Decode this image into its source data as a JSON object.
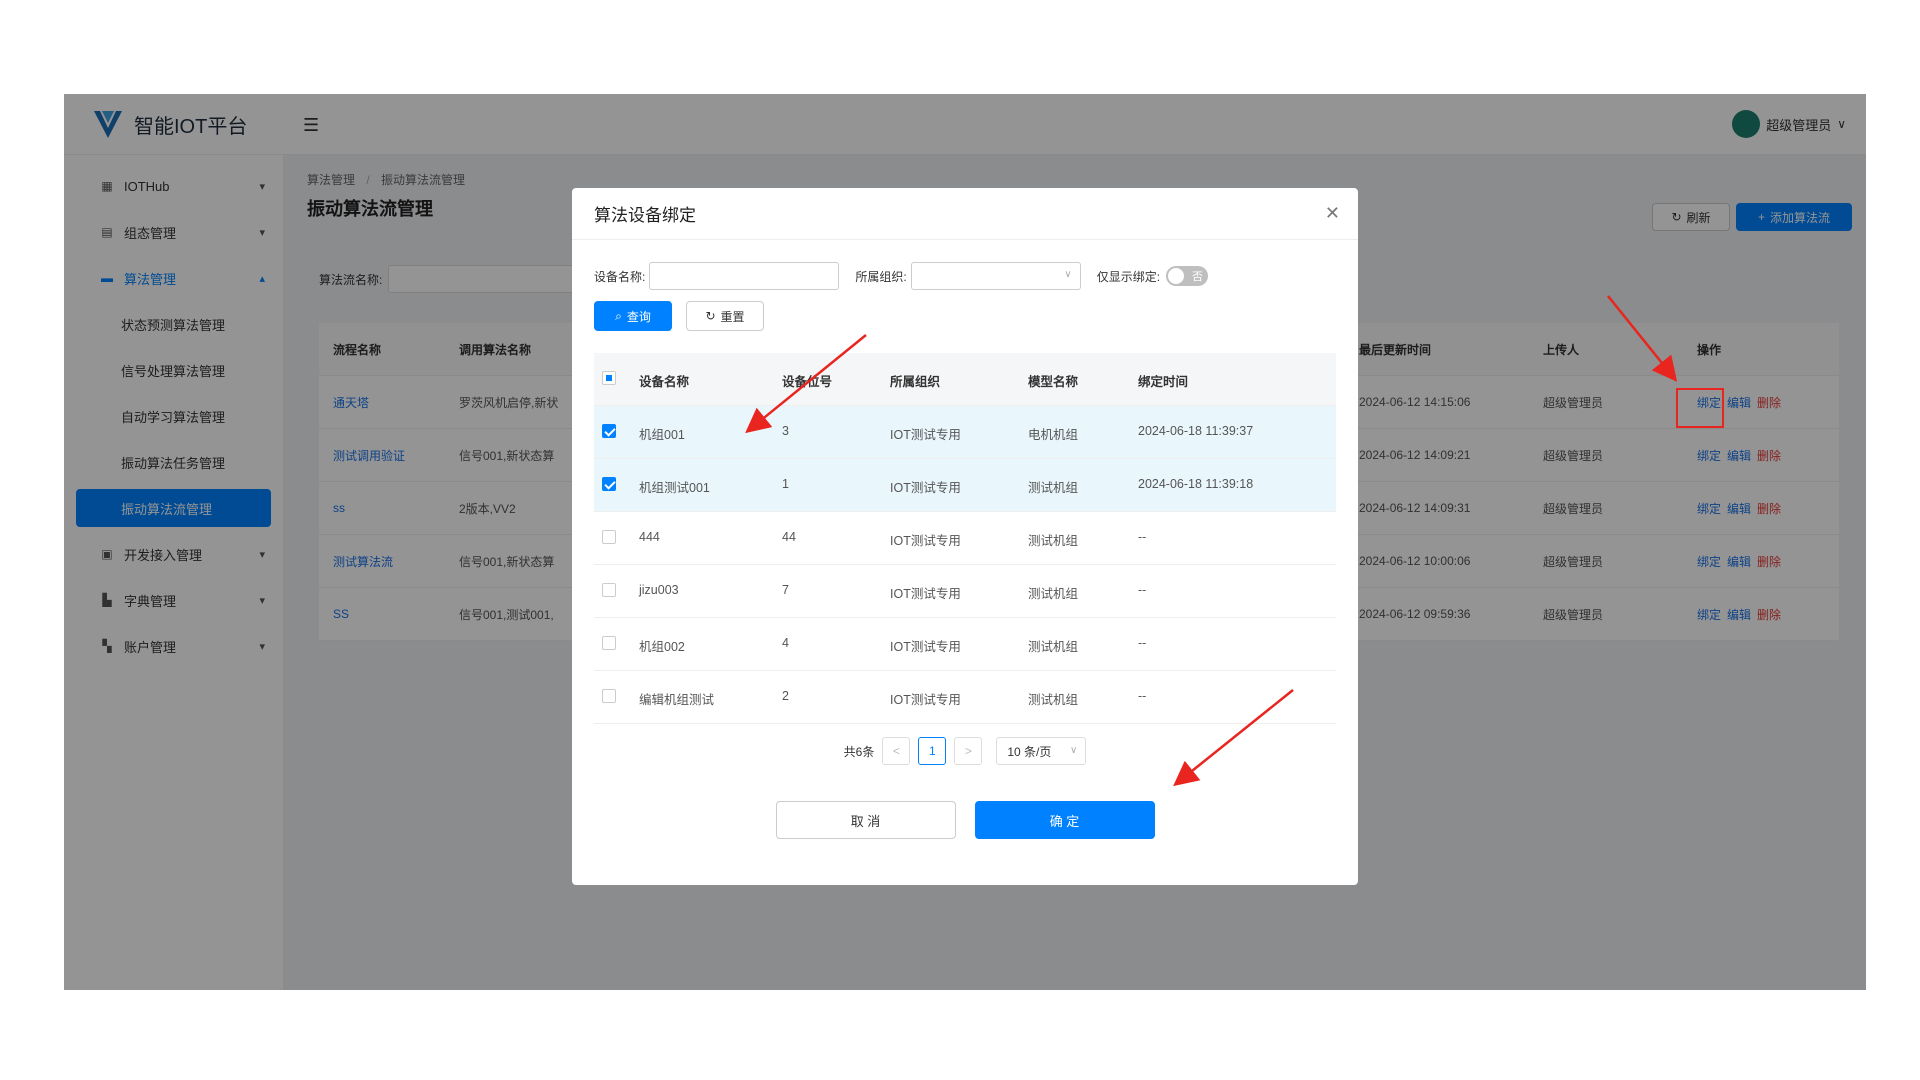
{
  "app": {
    "title": "智能IOT平台"
  },
  "header": {
    "user_name": "超级管理员"
  },
  "sidebar": {
    "items": [
      {
        "label": "IOTHub"
      },
      {
        "label": "组态管理"
      },
      {
        "label": "算法管理"
      },
      {
        "label": "开发接入管理"
      },
      {
        "label": "字典管理"
      },
      {
        "label": "账户管理"
      }
    ],
    "sub_items": [
      {
        "label": "状态预测算法管理"
      },
      {
        "label": "信号处理算法管理"
      },
      {
        "label": "自动学习算法管理"
      },
      {
        "label": "振动算法任务管理"
      },
      {
        "label": "振动算法流管理"
      }
    ]
  },
  "breadcrumb": {
    "parent": "算法管理",
    "sep": "/",
    "current": "振动算法流管理"
  },
  "page": {
    "title": "振动算法流管理",
    "refresh_label": "刷新",
    "add_label": "添加算法流",
    "filter_label": "算法流名称:"
  },
  "main_table": {
    "headers": {
      "name": "流程名称",
      "algo": "调用算法名称",
      "updated": "最后更新时间",
      "uploader": "上传人",
      "ops": "操作"
    },
    "actions": {
      "bind": "绑定",
      "edit": "编辑",
      "delete": "删除"
    },
    "rows": [
      {
        "name": "通天塔",
        "algo": "罗茨风机启停,新状",
        "updated": "2024-06-12 14:15:06",
        "uploader": "超级管理员"
      },
      {
        "name": "测试调用验证",
        "algo": "信号001,新状态算",
        "updated": "2024-06-12 14:09:21",
        "uploader": "超级管理员"
      },
      {
        "name": "ss",
        "algo": "2版本,VV2",
        "updated": "2024-06-12 14:09:31",
        "uploader": "超级管理员"
      },
      {
        "name": "测试算法流",
        "algo": "信号001,新状态算",
        "updated": "2024-06-12 10:00:06",
        "uploader": "超级管理员"
      },
      {
        "name": "SS",
        "algo": "信号001,测试001,",
        "updated": "2024-06-12 09:59:36",
        "uploader": "超级管理员"
      }
    ]
  },
  "modal": {
    "title": "算法设备绑定",
    "device_name_label": "设备名称:",
    "org_label": "所属组织:",
    "only_bound_label": "仅显示绑定:",
    "switch_text": "否",
    "query_label": "查询",
    "reset_label": "重置",
    "headers": {
      "name": "设备名称",
      "pos": "设备位号",
      "org": "所属组织",
      "model": "模型名称",
      "time": "绑定时间"
    },
    "rows": [
      {
        "checked": true,
        "name": "机组001",
        "pos": "3",
        "org": "IOT测试专用",
        "model": "电机机组",
        "time": "2024-06-18 11:39:37"
      },
      {
        "checked": true,
        "name": "机组测试001",
        "pos": "1",
        "org": "IOT测试专用",
        "model": "测试机组",
        "time": "2024-06-18 11:39:18"
      },
      {
        "checked": false,
        "name": "444",
        "pos": "44",
        "org": "IOT测试专用",
        "model": "测试机组",
        "time": "--"
      },
      {
        "checked": false,
        "name": "jizu003",
        "pos": "7",
        "org": "IOT测试专用",
        "model": "测试机组",
        "time": "--"
      },
      {
        "checked": false,
        "name": "机组002",
        "pos": "4",
        "org": "IOT测试专用",
        "model": "测试机组",
        "time": "--"
      },
      {
        "checked": false,
        "name": "编辑机组测试",
        "pos": "2",
        "org": "IOT测试专用",
        "model": "测试机组",
        "time": "--"
      }
    ],
    "pager": {
      "total": "共6条",
      "prev": "<",
      "page": "1",
      "next": ">",
      "size": "10 条/页"
    },
    "cancel_label": "取 消",
    "ok_label": "确 定"
  },
  "colors": {
    "primary": "#0081ff",
    "danger": "#e53935",
    "annotation": "#e8251e"
  }
}
